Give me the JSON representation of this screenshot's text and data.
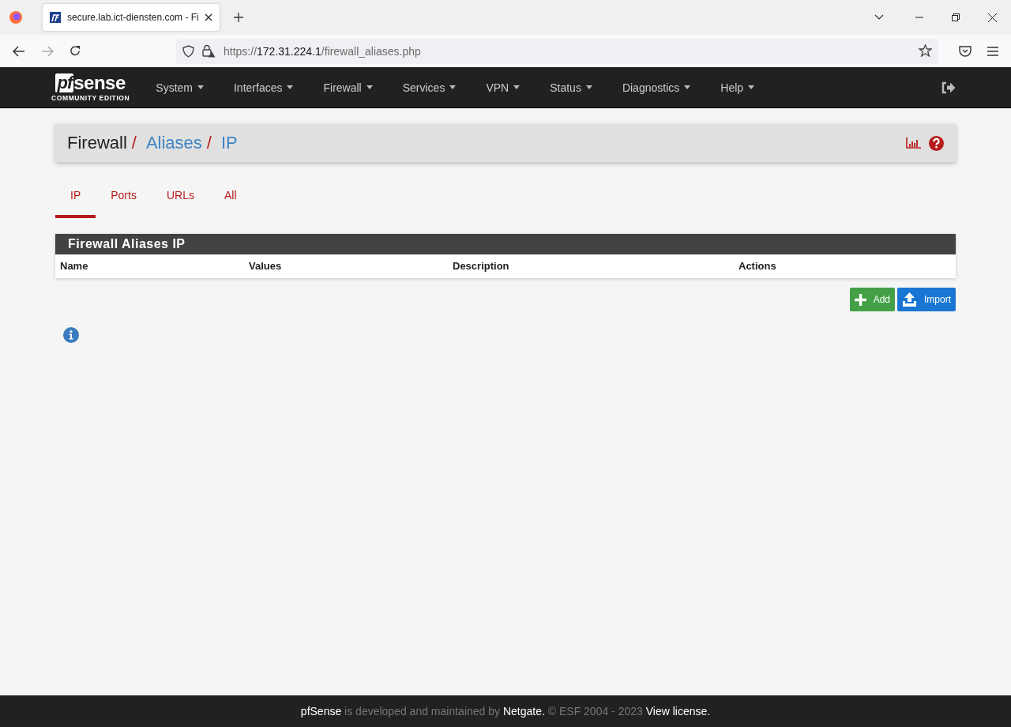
{
  "browser": {
    "tab": {
      "title": "secure.lab.ict-diensten.com - Fi",
      "selected": true
    },
    "url": {
      "scheme": "https://",
      "host": "172.31.224.1",
      "path": "/firewall_aliases.php"
    }
  },
  "logo": {
    "mark": "pf",
    "word": "sense",
    "edition": "COMMUNITY EDITION"
  },
  "nav": [
    {
      "label": "System"
    },
    {
      "label": "Interfaces"
    },
    {
      "label": "Firewall"
    },
    {
      "label": "Services"
    },
    {
      "label": "VPN"
    },
    {
      "label": "Status"
    },
    {
      "label": "Diagnostics"
    },
    {
      "label": "Help"
    }
  ],
  "breadcrumb": {
    "separator": "/",
    "items": [
      {
        "label": "Firewall",
        "kind": "text"
      },
      {
        "label": "Aliases",
        "kind": "link"
      },
      {
        "label": "IP",
        "kind": "link"
      }
    ]
  },
  "tabs": [
    {
      "label": "IP",
      "selected": true
    },
    {
      "label": "Ports",
      "selected": false
    },
    {
      "label": "URLs",
      "selected": false
    },
    {
      "label": "All",
      "selected": false
    }
  ],
  "panel": {
    "title": "Firewall Aliases IP",
    "columns": [
      "Name",
      "Values",
      "Description",
      "Actions"
    ]
  },
  "buttons": [
    {
      "label": "Add",
      "kind": "add"
    },
    {
      "label": "Import",
      "kind": "import"
    }
  ],
  "footer": [
    {
      "text": "pfSense",
      "kind": "link"
    },
    {
      "text": "is developed and maintained by",
      "kind": "text"
    },
    {
      "text": "Netgate.",
      "kind": "link"
    },
    {
      "text": "© ESF 2004 - 2023",
      "kind": "text"
    },
    {
      "text": "View license.",
      "kind": "link"
    }
  ]
}
